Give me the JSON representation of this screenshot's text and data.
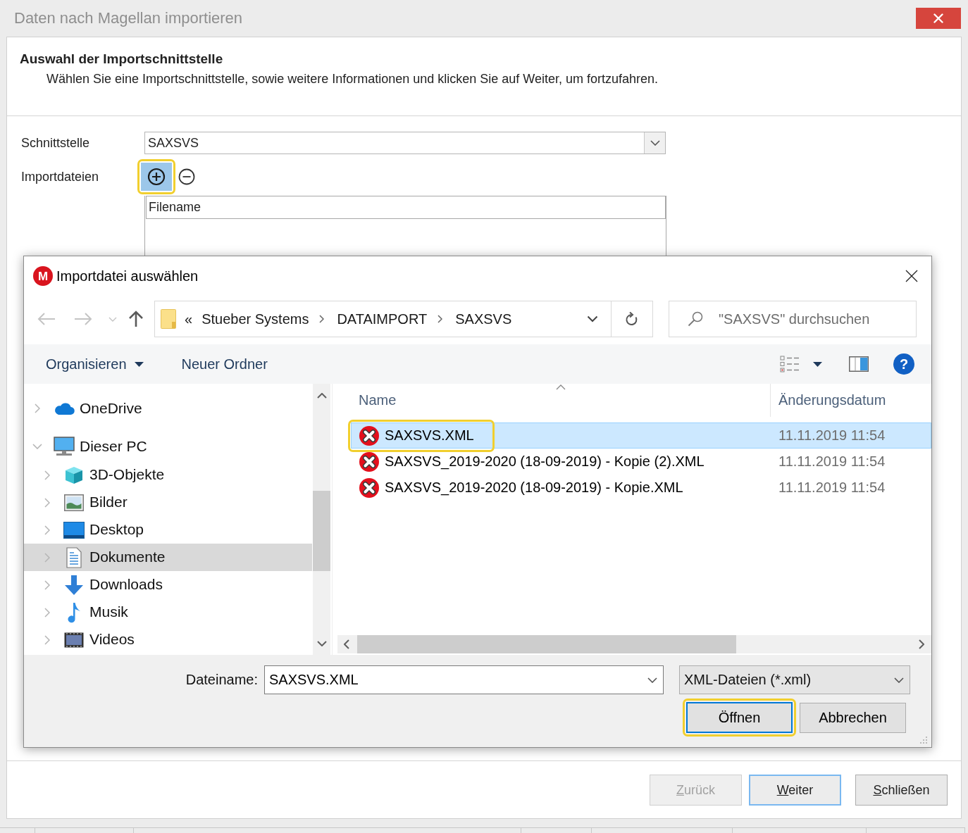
{
  "window": {
    "title": "Daten nach Magellan importieren"
  },
  "header": {
    "title": "Auswahl der Importschnittstelle",
    "description": "Wählen Sie eine Importschnittstelle, sowie weitere Informationen und klicken Sie auf Weiter, um fortzufahren."
  },
  "form": {
    "interface_label": "Schnittstelle",
    "interface_value": "SAXSVS",
    "import_files_label": "Importdateien",
    "file_buttons": [
      {
        "kind": "add",
        "hovered": true,
        "highlighted": true
      },
      {
        "kind": "remove",
        "hovered": false,
        "highlighted": false
      }
    ],
    "file_list_columns": [
      "Filename"
    ]
  },
  "file_dialog": {
    "logo_letter": "M",
    "title": "Importdatei auswählen",
    "navigation": [
      {
        "kind": "back",
        "disabled": true
      },
      {
        "kind": "forward",
        "disabled": true
      },
      {
        "kind": "recent",
        "disabled": true
      },
      {
        "kind": "up",
        "disabled": false
      }
    ],
    "address": {
      "overflow": "«",
      "crumbs": [
        "Stueber Systems",
        "DATAIMPORT",
        "SAXSVS"
      ]
    },
    "search": {
      "placeholder": "\"SAXSVS\" durchsuchen"
    },
    "toolbar": {
      "organize": "Organisieren",
      "new_folder": "Neuer Ordner",
      "help_glyph": "?"
    },
    "tree": [
      {
        "label": "OneDrive",
        "kind": "cloud",
        "expanded": false,
        "selected": false
      },
      {
        "label": "Dieser PC",
        "kind": "computer",
        "expanded": true,
        "selected": false,
        "children": [
          {
            "label": "3D-Objekte",
            "kind": "objects3d",
            "expanded": false,
            "selected": false
          },
          {
            "label": "Bilder",
            "kind": "pictures",
            "expanded": false,
            "selected": false
          },
          {
            "label": "Desktop",
            "kind": "desktop",
            "expanded": false,
            "selected": false
          },
          {
            "label": "Dokumente",
            "kind": "documents",
            "expanded": false,
            "selected": true
          },
          {
            "label": "Downloads",
            "kind": "downloads",
            "expanded": false,
            "selected": false
          },
          {
            "label": "Musik",
            "kind": "music",
            "expanded": false,
            "selected": false
          },
          {
            "label": "Videos",
            "kind": "videos",
            "expanded": false,
            "selected": false
          }
        ]
      }
    ],
    "columns": [
      {
        "label": "Name",
        "sorted": true
      },
      {
        "label": "Änderungsdatum",
        "sorted": false
      }
    ],
    "files": [
      {
        "name": "SAXSVS.XML",
        "modified": "11.11.2019 11:54",
        "selected": true,
        "highlighted": true
      },
      {
        "name": "SAXSVS_2019-2020 (18-09-2019) - Kopie (2).XML",
        "modified": "11.11.2019 11:54",
        "selected": false,
        "highlighted": false
      },
      {
        "name": "SAXSVS_2019-2020 (18-09-2019) - Kopie.XML",
        "modified": "11.11.2019 11:54",
        "selected": false,
        "highlighted": false
      }
    ],
    "filename_label": "Dateiname:",
    "filename_value": "SAXSVS.XML",
    "file_type": "XML-Dateien (*.xml)",
    "buttons": [
      {
        "label": "Öffnen",
        "default": true,
        "highlighted": true
      },
      {
        "label": "Abbrechen",
        "default": false,
        "highlighted": false
      }
    ]
  },
  "buttons": [
    {
      "label": "Zurück",
      "disabled": true,
      "focused": false
    },
    {
      "label": "Weiter",
      "disabled": false,
      "focused": true
    },
    {
      "label": "Schließen",
      "disabled": false,
      "focused": false
    }
  ]
}
